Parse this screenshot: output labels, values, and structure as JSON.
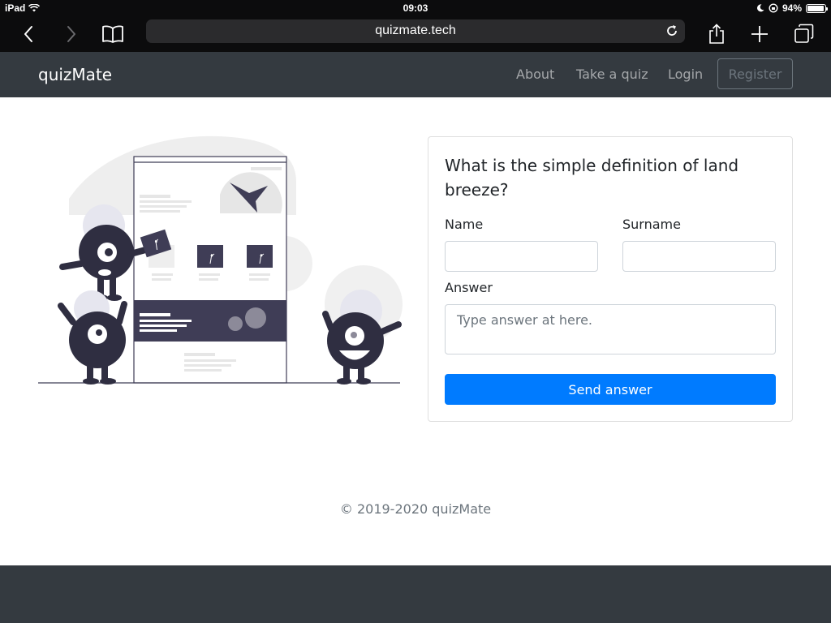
{
  "status_bar": {
    "device": "iPad",
    "time": "09:03",
    "battery": "94%",
    "battery_level": 0.94
  },
  "browser": {
    "url": "quizmate.tech"
  },
  "navbar": {
    "brand": "quizMate",
    "links": [
      "About",
      "Take a quiz",
      "Login"
    ],
    "register_label": "Register"
  },
  "quiz": {
    "question": "What is the simple definition of land breeze?",
    "name_label": "Name",
    "name_value": "",
    "surname_label": "Surname",
    "surname_value": "",
    "answer_label": "Answer",
    "answer_placeholder": "Type answer at here.",
    "submit_label": "Send answer"
  },
  "footer": {
    "copyright": "© 2019-2020 quizMate"
  },
  "colors": {
    "navbar_bg": "#343a40",
    "primary": "#007bff",
    "illustration_dark": "#3f3d56",
    "illustration_light": "#e6e6e6"
  }
}
